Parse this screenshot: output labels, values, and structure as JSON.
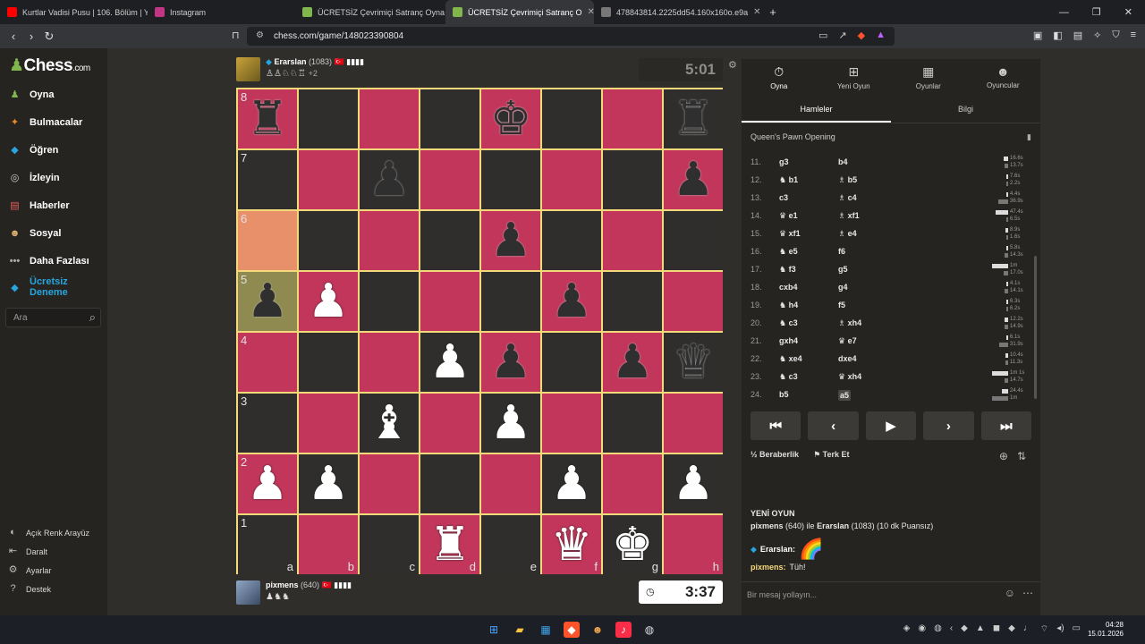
{
  "browser": {
    "tabs": [
      {
        "label": "Kurtlar Vadisi Pusu | 106. Bölüm | Yük",
        "color": "#ff0000",
        "active": false
      },
      {
        "label": "Instagram",
        "color": "#c13584",
        "active": false
      },
      {
        "label": "ÜCRETSİZ Çevrimiçi Satranç Oyna",
        "color": "#81b64c",
        "active": false
      },
      {
        "label": "ÜCRETSİZ Çevrimiçi Satranç O",
        "color": "#81b64c",
        "active": true
      },
      {
        "label": "478843814.2225dd54.160x160o.e9a",
        "color": "#777777",
        "active": false
      }
    ],
    "new_tab": "+",
    "url": "chess.com/game/148023390804"
  },
  "site": {
    "logo_text": "Chess",
    "logo_suffix": ".com",
    "menu": [
      {
        "label": "Oyna",
        "icon": "pawn-icon",
        "color": "#81b64c",
        "glyph": "♟"
      },
      {
        "label": "Bulmacalar",
        "icon": "puzzle-icon",
        "color": "#f08a24",
        "glyph": "✦"
      },
      {
        "label": "Öğren",
        "icon": "learn-icon",
        "color": "#27a5de",
        "glyph": "◆"
      },
      {
        "label": "İzleyin",
        "icon": "binoculars-icon",
        "color": "#cccccc",
        "glyph": "◎"
      },
      {
        "label": "Haberler",
        "icon": "news-icon",
        "color": "#e85d5d",
        "glyph": "▤"
      },
      {
        "label": "Sosyal",
        "icon": "social-icon",
        "color": "#e0b070",
        "glyph": "☻"
      },
      {
        "label": "Daha Fazlası",
        "icon": "more-icon",
        "color": "#aaaaaa",
        "glyph": "•••"
      },
      {
        "label": "Ücretsiz Deneme",
        "icon": "diamond-icon",
        "color": "#27a5de",
        "glyph": "◆"
      }
    ],
    "search_placeholder": "Ara",
    "bottom_menu": [
      {
        "label": "Açık Renk Arayüz",
        "icon": "contrast-icon",
        "glyph": "◐"
      },
      {
        "label": "Daralt",
        "icon": "collapse-icon",
        "glyph": "⇤"
      },
      {
        "label": "Ayarlar",
        "icon": "settings-icon",
        "glyph": "⚙"
      },
      {
        "label": "Destek",
        "icon": "help-icon",
        "glyph": "?"
      }
    ]
  },
  "game": {
    "top_player": {
      "name": "Erarslan",
      "rating": "(1083)",
      "flag": "🇹🇷",
      "captured": "♙♙♘♘♖",
      "captured_extra": "+2",
      "clock": "5:01"
    },
    "bottom_player": {
      "name": "pixmens",
      "rating": "(640)",
      "flag": "🇹🇷",
      "captured": "♟♞♞",
      "clock": "3:37"
    },
    "board": [
      [
        "br",
        "",
        "",
        "",
        "bk",
        "",
        "",
        "br"
      ],
      [
        "",
        "",
        "bp",
        "",
        "",
        "",
        "",
        "bp"
      ],
      [
        "",
        "",
        "",
        "",
        "bp",
        "",
        "",
        ""
      ],
      [
        "bp",
        "wp",
        "",
        "",
        "",
        "bp",
        "",
        ""
      ],
      [
        "",
        "",
        "",
        "wp",
        "bp",
        "",
        "bp",
        "bq"
      ],
      [
        "",
        "",
        "wb",
        "",
        "wp",
        "",
        "",
        ""
      ],
      [
        "wp",
        "wp",
        "",
        "",
        "",
        "wp",
        "",
        "wp"
      ],
      [
        "",
        "",
        "",
        "wr",
        "",
        "wq",
        "wk",
        ""
      ]
    ],
    "ranks": [
      "8",
      "7",
      "6",
      "5",
      "4",
      "3",
      "2",
      "1"
    ],
    "files": [
      "a",
      "b",
      "c",
      "d",
      "e",
      "f",
      "g",
      "h"
    ],
    "highlight": {
      "from": "a6",
      "to": "a5"
    }
  },
  "panel": {
    "tabs": [
      {
        "label": "Oyna",
        "glyph": "⏱",
        "icon": "stopwatch-icon"
      },
      {
        "label": "Yeni Oyun",
        "glyph": "⊞",
        "icon": "new-game-icon"
      },
      {
        "label": "Oyunlar",
        "glyph": "▦",
        "icon": "games-icon"
      },
      {
        "label": "Oyuncular",
        "glyph": "☻",
        "icon": "players-icon"
      }
    ],
    "subtabs": [
      "Hamleler",
      "Bilgi"
    ],
    "opening": "Queen's Pawn Opening",
    "moves": [
      {
        "num": "11.",
        "white": "g3",
        "black": "b4",
        "wt": "16.6s",
        "bt": "13.7s",
        "wf": 0.12,
        "bf": 0.1
      },
      {
        "num": "12.",
        "white": "♞ b1",
        "black": "♗ b5",
        "wt": "7.6s",
        "bt": "2.2s",
        "wf": 0.06,
        "bf": 0.02
      },
      {
        "num": "13.",
        "white": "c3",
        "black": "♗ c4",
        "wt": "4.4s",
        "bt": "36.9s",
        "wf": 0.04,
        "bf": 0.27
      },
      {
        "num": "14.",
        "white": "♛ e1",
        "black": "♗ xf1",
        "wt": "47.4s",
        "bt": "6.5s",
        "wf": 0.35,
        "bf": 0.05
      },
      {
        "num": "15.",
        "white": "♛ xf1",
        "black": "♗ e4",
        "wt": "8.9s",
        "bt": "1.6s",
        "wf": 0.07,
        "bf": 0.01
      },
      {
        "num": "16.",
        "white": "♞ e5",
        "black": "f6",
        "wt": "5.8s",
        "bt": "14.3s",
        "wf": 0.04,
        "bf": 0.11
      },
      {
        "num": "17.",
        "white": "♞ f3",
        "black": "g5",
        "wt": "1m",
        "bt": "17.0s",
        "wf": 0.45,
        "bf": 0.13
      },
      {
        "num": "18.",
        "white": "cxb4",
        "black": "g4",
        "wt": "4.1s",
        "bt": "14.1s",
        "wf": 0.03,
        "bf": 0.1
      },
      {
        "num": "19.",
        "white": "♞ h4",
        "black": "f5",
        "wt": "6.3s",
        "bt": "6.2s",
        "wf": 0.05,
        "bf": 0.05
      },
      {
        "num": "20.",
        "white": "♞ c3",
        "black": "♗ xh4",
        "wt": "12.2s",
        "bt": "14.9s",
        "wf": 0.09,
        "bf": 0.11
      },
      {
        "num": "21.",
        "white": "gxh4",
        "black": "♛ e7",
        "wt": "6.1s",
        "bt": "31.9s",
        "wf": 0.05,
        "bf": 0.24
      },
      {
        "num": "22.",
        "white": "♞ xe4",
        "black": "dxe4",
        "wt": "10.4s",
        "bt": "11.3s",
        "wf": 0.08,
        "bf": 0.08
      },
      {
        "num": "23.",
        "white": "♞ c3",
        "black": "♛ xh4",
        "wt": "1m 1s",
        "bt": "14.7s",
        "wf": 0.46,
        "bf": 0.11
      },
      {
        "num": "24.",
        "white": "b5",
        "black": "a5",
        "wt": "24.4s",
        "bt": "1m",
        "wf": 0.18,
        "bf": 0.45,
        "current": true
      }
    ],
    "controls": [
      "⏮",
      "‹",
      "▶",
      "›",
      "⏭"
    ],
    "draw_label": "Beraberlik",
    "draw_glyph": "½",
    "resign_label": "Terk Et",
    "chat": {
      "title": "YENİ OYUN",
      "info_p1": "pixmens",
      "info_p1_rating": "(640)",
      "info_mid": "ile",
      "info_p2": "Erarslan",
      "info_p2_rating": "(1083)",
      "info_tail": "(10 dk Puansız)",
      "msg1_name": "Erarslan:",
      "msg1_text": "🌈",
      "msg2_name": "pixmens:",
      "msg2_text": "Tüh!",
      "input_placeholder": "Bir mesaj yollayın..."
    }
  },
  "taskbar": {
    "time": "04:28",
    "date": "15.01.2026"
  }
}
